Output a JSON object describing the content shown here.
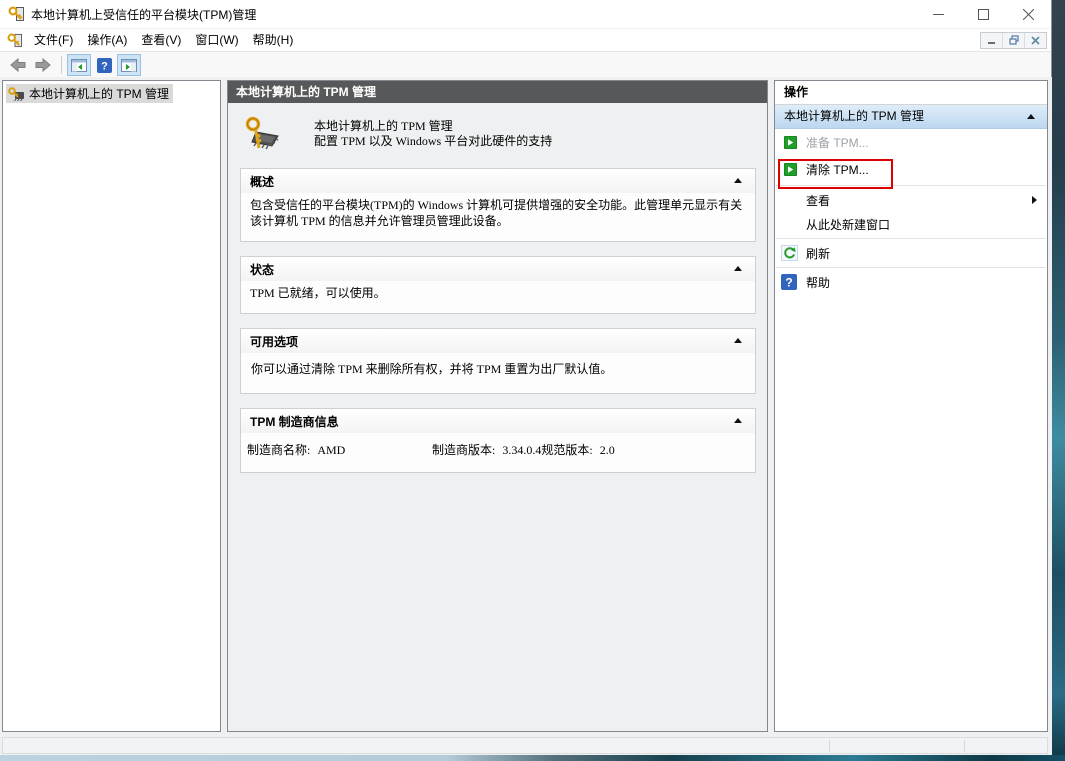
{
  "window": {
    "title": "本地计算机上受信任的平台模块(TPM)管理"
  },
  "menu": {
    "items": [
      "文件(F)",
      "操作(A)",
      "查看(V)",
      "窗口(W)",
      "帮助(H)"
    ]
  },
  "icons": {
    "help_glyph": "?"
  },
  "tree": {
    "root_label": "本地计算机上的 TPM 管理"
  },
  "main": {
    "header_title": "本地计算机上的 TPM 管理",
    "intro_title": "本地计算机上的 TPM 管理",
    "intro_subtitle": "配置 TPM 以及 Windows 平台对此硬件的支持",
    "sections": {
      "overview": {
        "title": "概述",
        "body": "包含受信任的平台模块(TPM)的 Windows 计算机可提供增强的安全功能。此管理单元显示有关该计算机 TPM 的信息并允许管理员管理此设备。"
      },
      "status": {
        "title": "状态",
        "body": "TPM 已就绪，可以使用。"
      },
      "options": {
        "title": "可用选项",
        "body": "你可以通过清除 TPM 来删除所有权，并将 TPM 重置为出厂默认值。"
      },
      "manufacturer": {
        "title": "TPM 制造商信息",
        "fields": [
          {
            "label": "制造商名称:",
            "value": "AMD"
          },
          {
            "label": "制造商版本:",
            "value": "3.34.0.4"
          },
          {
            "label": "规范版本:",
            "value": "2.0"
          }
        ]
      }
    }
  },
  "actions": {
    "title": "操作",
    "group_title": "本地计算机上的 TPM 管理",
    "prepare": "准备 TPM...",
    "clear": "清除 TPM...",
    "view": "查看",
    "new_window": "从此处新建窗口",
    "refresh": "刷新",
    "help": "帮助"
  },
  "colors": {
    "highlight_box": "#dd0202",
    "action_green": "#1f9f27",
    "help_blue": "#3165bd",
    "center_header_gray": "#57585a",
    "group_header_blue": "#cfe1f3"
  }
}
